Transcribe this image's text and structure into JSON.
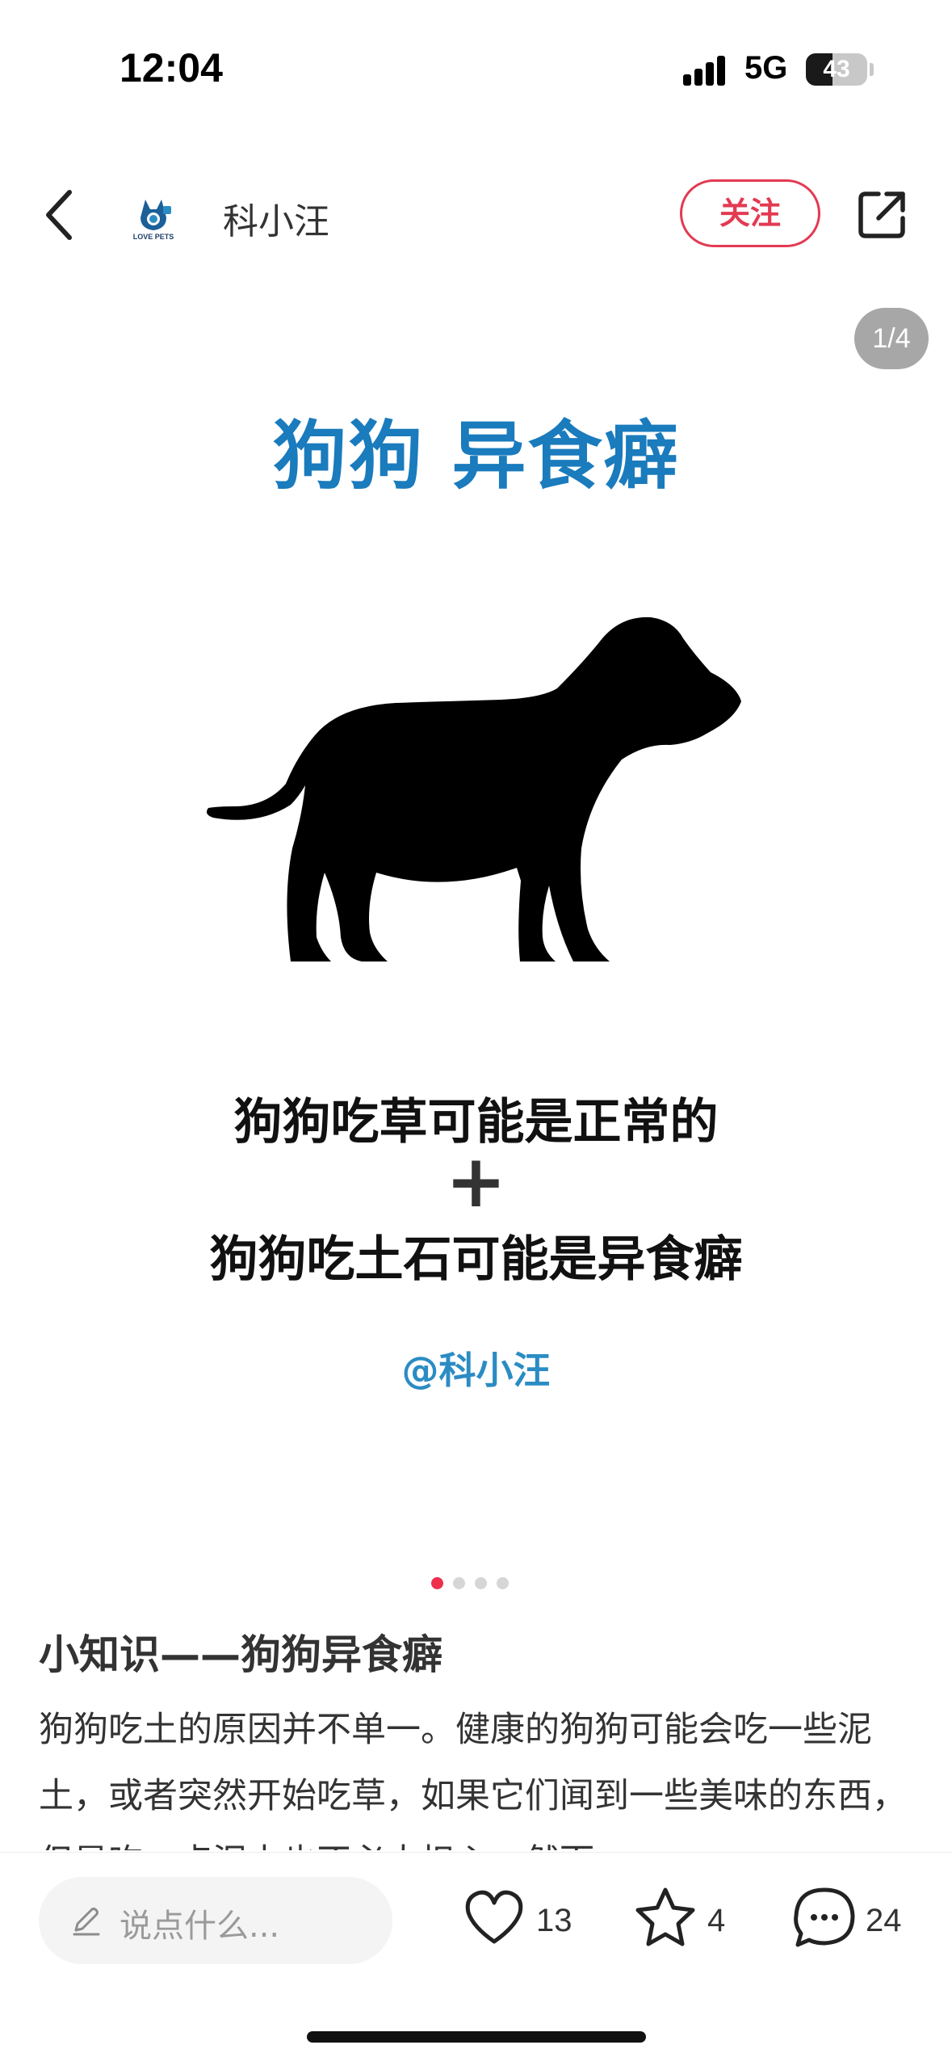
{
  "status_bar": {
    "time": "12:04",
    "network": "5G",
    "battery": "43",
    "battery_level_percent": 43
  },
  "header": {
    "back_icon": "chevron-left-icon",
    "avatar_text": "LOVE PETS",
    "author_name": "科小汪",
    "follow_label": "关注",
    "share_icon": "share-external-icon"
  },
  "post_image": {
    "page_counter": "1/4",
    "title": "狗狗 异食癖",
    "line1": "狗狗吃草可能是正常的",
    "plus": "+",
    "line2": "狗狗吃土石可能是异食癖",
    "handle": "@科小汪"
  },
  "pagination": {
    "total": 4,
    "active": 1
  },
  "post": {
    "title": "小知识——狗狗异食癖",
    "body": "狗狗吃土的原因并不单一。健康的狗狗可能会吃一些泥土，或者突然开始吃草，如果它们闻到一些美味的东西，但是吃一点泥土也不必太担心，然而"
  },
  "bottom_bar": {
    "comment_placeholder": "说点什么...",
    "likes": "13",
    "favorites": "4",
    "comments": "24"
  },
  "colors": {
    "accent": "#e33a52",
    "title_blue": "#1a7bbd",
    "handle_blue": "#2b8cc4"
  }
}
